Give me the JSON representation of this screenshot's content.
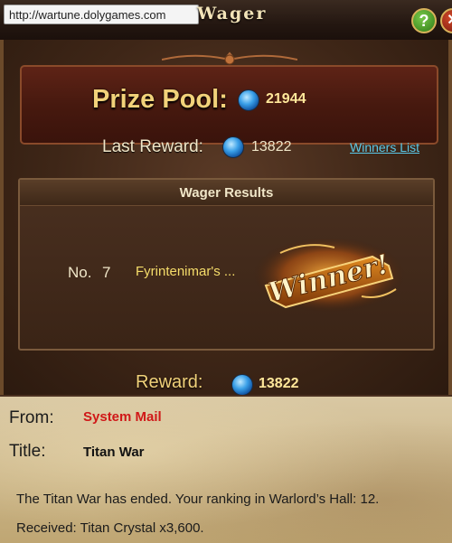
{
  "window": {
    "url": "http://wartune.dolygames.com",
    "title": "Wager",
    "help_icon": "?",
    "close_icon": "✕"
  },
  "prize_pool": {
    "label": "Prize Pool:",
    "value": "21944"
  },
  "last_reward": {
    "label": "Last Reward:",
    "value": "13822"
  },
  "winners_link": "Winners List",
  "wager_results": {
    "title": "Wager Results",
    "rank_label": "No.",
    "rank_value": "7",
    "winner_name": "Fyrintenimar's ...",
    "badge_text": "Winner!"
  },
  "reward": {
    "label": "Reward:",
    "value": "13822"
  },
  "mail": {
    "from_label": "From:",
    "from_value": "System Mail",
    "title_label": "Title:",
    "title_value": "Titan War",
    "body": "The Titan War has ended. Your ranking in Warlord’s Hall: 12. Received: Titan Crystal x3,600."
  },
  "colors": {
    "gold_text": "#f2d27a",
    "link": "#5ac8e8",
    "sender_red": "#d01818"
  }
}
